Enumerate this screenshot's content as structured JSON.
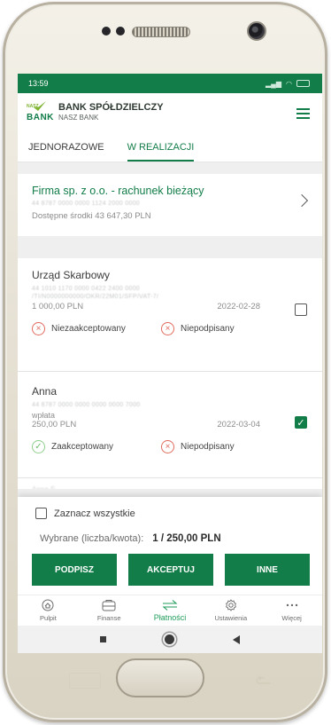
{
  "status_bar": {
    "time": "13:59"
  },
  "bank": {
    "logo_small": "NASZ",
    "logo_big": "BANK",
    "name": "BANK SPÓŁDZIELCZY",
    "subname": "NASZ BANK"
  },
  "tabs": [
    {
      "label": "JEDNORAZOWE",
      "active": false
    },
    {
      "label": "W REALIZACJI",
      "active": true
    }
  ],
  "account": {
    "name": "Firma sp. z o.o. - rachunek bieżący",
    "number_masked": "44 8787 0000 0000 1124 2000 0000",
    "balance": "Dostępne środki 43 647,30 PLN"
  },
  "payments": [
    {
      "payee": "Urząd Skarbowy",
      "details_masked_1": "44 1010 1170 0000 0422 2400 0000",
      "details_masked_2": "/TI/N0000000000/OKR/22M01/SFP/VAT-7/",
      "description": "",
      "amount": "1 000,00 PLN",
      "date": "2022-02-28",
      "acceptance_status": "Niezaakceptowany",
      "signature_status": "Niepodpisany",
      "selected": false
    },
    {
      "payee": "Anna",
      "details_masked_1": "44 8787 0000 0000 0000 0000 7000",
      "details_masked_2": "",
      "description": "wpłata",
      "amount": "250,00 PLN",
      "date": "2022-03-04",
      "acceptance_status": "Zaakceptowany",
      "signature_status": "Niepodpisany",
      "selected": true
    }
  ],
  "next_item_peek": "Anna S...",
  "footer": {
    "select_all_label": "Zaznacz wszystkie",
    "selected_label": "Wybrane (liczba/kwota):",
    "selected_value": "1 / 250,00 PLN",
    "buttons": [
      "PODPISZ",
      "AKCEPTUJ",
      "INNE"
    ]
  },
  "bottom_nav": [
    {
      "label": "Pulpit",
      "icon": "home-icon"
    },
    {
      "label": "Finanse",
      "icon": "wallet-icon"
    },
    {
      "label": "Płatności",
      "icon": "transfer-arrows-icon",
      "active": true
    },
    {
      "label": "Ustawienia",
      "icon": "gear-icon"
    },
    {
      "label": "Więcej",
      "icon": "more-dots-icon"
    }
  ],
  "colors": {
    "brand_green": "#127d48",
    "accent_green": "#1f9c5a",
    "error_red": "#e06a5e",
    "success_green": "#6dbd6a"
  }
}
